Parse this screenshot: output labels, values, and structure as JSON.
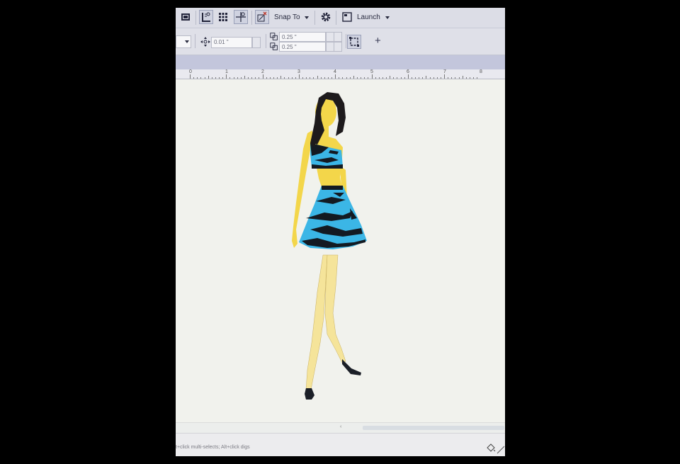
{
  "toolbar": {
    "snap_to_label": "Snap To",
    "launch_label": "Launch",
    "nudge_value": "0.01 \"",
    "dup_x_value": "0.25 \"",
    "dup_y_value": "0.25 \"",
    "add_symbol": "+",
    "icons": [
      "frame-icon",
      "show-rulers-icon",
      "show-grid-icon",
      "guidelines-icon",
      "snap-icon",
      "options-gear-icon",
      "launch-app-icon",
      "nudge-icon",
      "duplicate-distance-icon",
      "treat-as-filled-icon"
    ]
  },
  "ruler": {
    "labels": [
      "0",
      "1",
      "2",
      "3",
      "4",
      "5",
      "6",
      "7",
      "8"
    ]
  },
  "canvas": {
    "artwork": "fashion-figure-illustration",
    "colors": {
      "skin": "#f3d64a",
      "skin_light": "#f5e49a",
      "hair": "#1d1a1c",
      "clothing": "#3bb6e6",
      "stripes": "#131a22"
    }
  },
  "status": {
    "hint_text": "t+click multi-selects; Alt+click digs"
  }
}
